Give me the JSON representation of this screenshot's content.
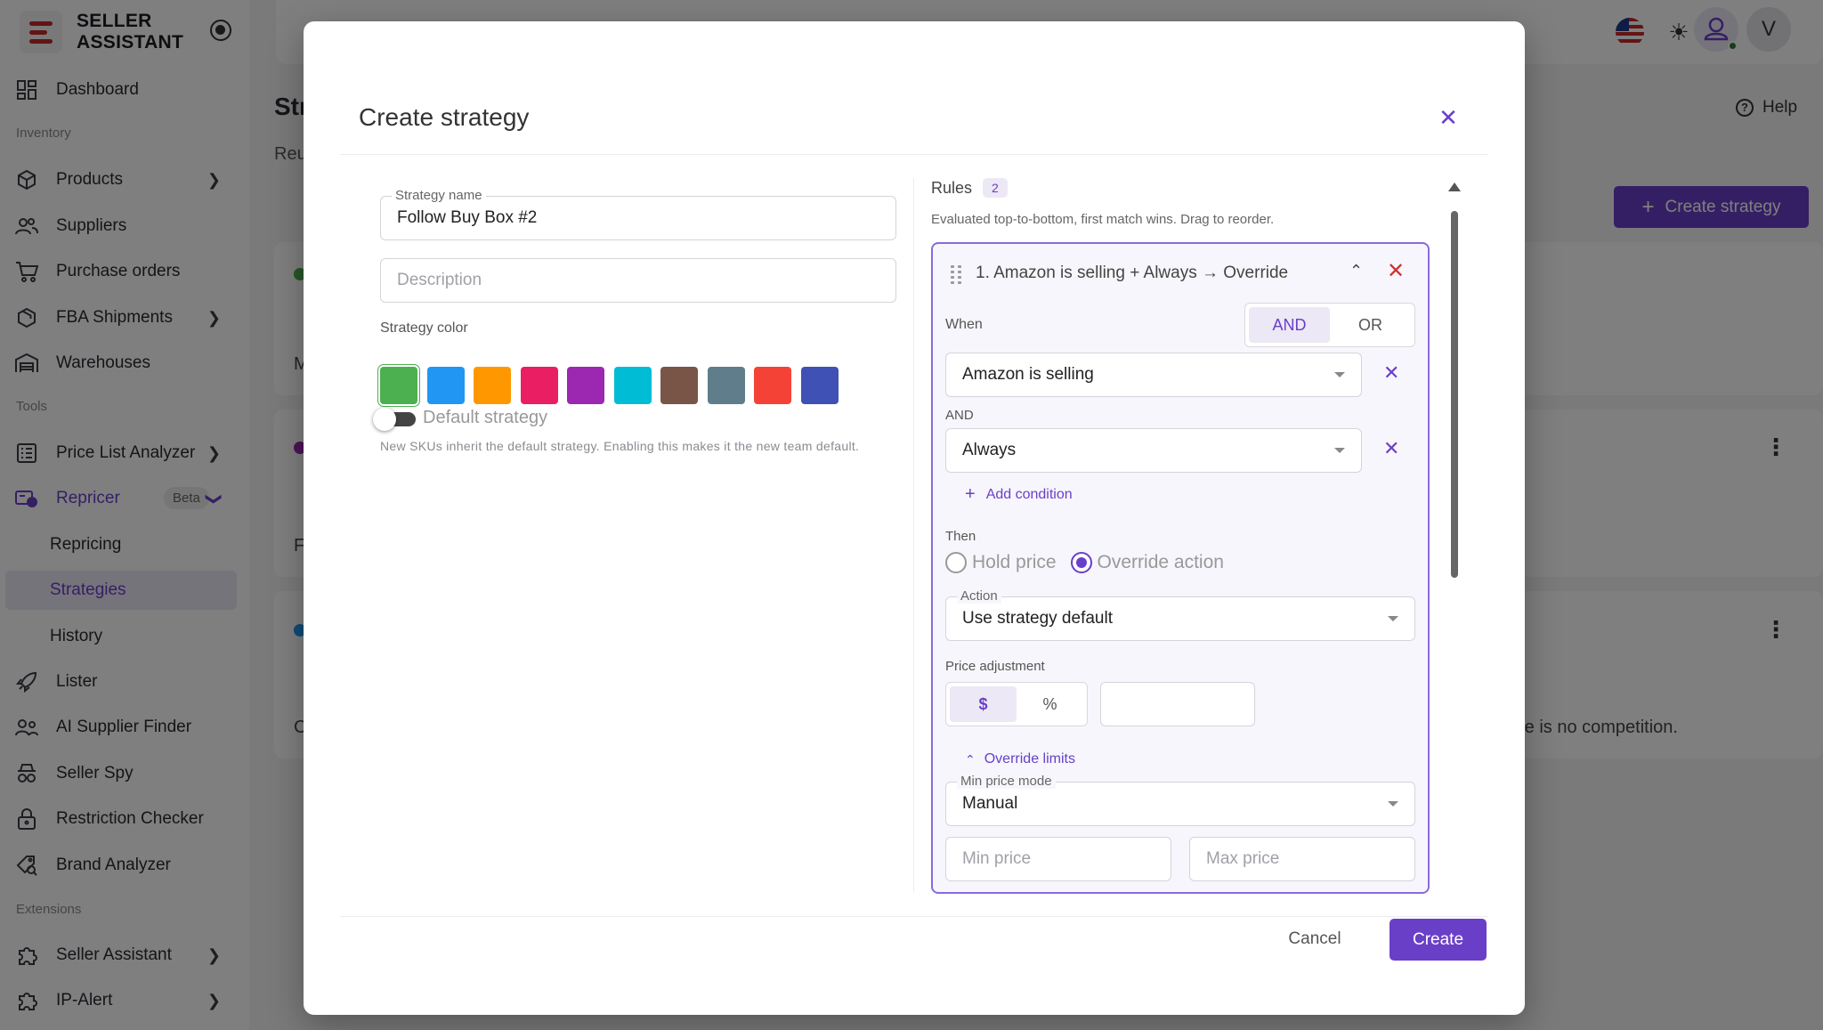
{
  "brand": {
    "line1": "SELLER",
    "line2": "ASSISTANT"
  },
  "sidebar": {
    "sections": [
      "Inventory",
      "Tools",
      "Extensions"
    ],
    "items": [
      {
        "label": "Dashboard",
        "icon": "dashboard-icon"
      },
      {
        "label": "Products",
        "icon": "box-icon"
      },
      {
        "label": "Suppliers",
        "icon": "users-icon"
      },
      {
        "label": "Purchase orders",
        "icon": "cart-icon"
      },
      {
        "label": "FBA Shipments",
        "icon": "package-icon"
      },
      {
        "label": "Warehouses",
        "icon": "warehouse-icon"
      },
      {
        "label": "Price List Analyzer",
        "icon": "list-icon"
      },
      {
        "label": "Repricer",
        "icon": "repricer-icon",
        "badge": "Beta"
      },
      {
        "label": "Repricing",
        "icon": ""
      },
      {
        "label": "Strategies",
        "icon": ""
      },
      {
        "label": "History",
        "icon": ""
      },
      {
        "label": "Lister",
        "icon": "rocket-icon"
      },
      {
        "label": "AI Supplier Finder",
        "icon": "people-icon"
      },
      {
        "label": "Seller Spy",
        "icon": "spy-icon"
      },
      {
        "label": "Restriction Checker",
        "icon": "lock-icon"
      },
      {
        "label": "Brand Analyzer",
        "icon": "brand-search-icon"
      },
      {
        "label": "Seller Assistant",
        "icon": "puzzle-icon"
      },
      {
        "label": "IP-Alert",
        "icon": "puzzle-icon"
      }
    ]
  },
  "background": {
    "title": "Str",
    "subtitle": "Reu",
    "create_button": "Create strategy",
    "help": "Help",
    "avatar_letter": "V",
    "row_text_1": "M",
    "row_text_2": "F",
    "row_text_3": "C",
    "row_text_3_tail": "re is no competition."
  },
  "modal": {
    "title": "Create strategy",
    "strategy_name_label": "Strategy name",
    "strategy_name_value": "Follow Buy Box #2",
    "description_placeholder": "Description",
    "strategy_color_label": "Strategy color",
    "colors": [
      "#4caf50",
      "#2196f3",
      "#ff9800",
      "#e91e63",
      "#9c27b0",
      "#00bcd4",
      "#795548",
      "#607d8b",
      "#f44336",
      "#3f51b5"
    ],
    "selected_color": "#4caf50",
    "default_strategy_label": "Default strategy",
    "default_strategy_on": false,
    "default_hint": "New SKUs inherit the default strategy. Enabling this makes it the new team default.",
    "rules_label": "Rules",
    "rules_count": "2",
    "rules_desc": "Evaluated top-to-bottom, first match wins. Drag to reorder.",
    "rule": {
      "title": "1.  Amazon is selling + Always  →  Override",
      "when_label": "When",
      "logic_and": "AND",
      "logic_or": "OR",
      "condition_1": "Amazon is selling",
      "and_label": "AND",
      "condition_2": "Always",
      "add_condition": "Add condition",
      "then_label": "Then",
      "hold_price": "Hold price",
      "override_action": "Override action",
      "action_label": "Action",
      "action_value": "Use strategy default",
      "price_adjustment_label": "Price adjustment",
      "unit_dollar": "$",
      "unit_percent": "%",
      "override_limits": "Override limits",
      "min_price_mode_label": "Min price mode",
      "min_price_mode_value": "Manual",
      "min_price_placeholder": "Min price",
      "max_price_placeholder": "Max price"
    },
    "cancel": "Cancel",
    "create": "Create"
  }
}
